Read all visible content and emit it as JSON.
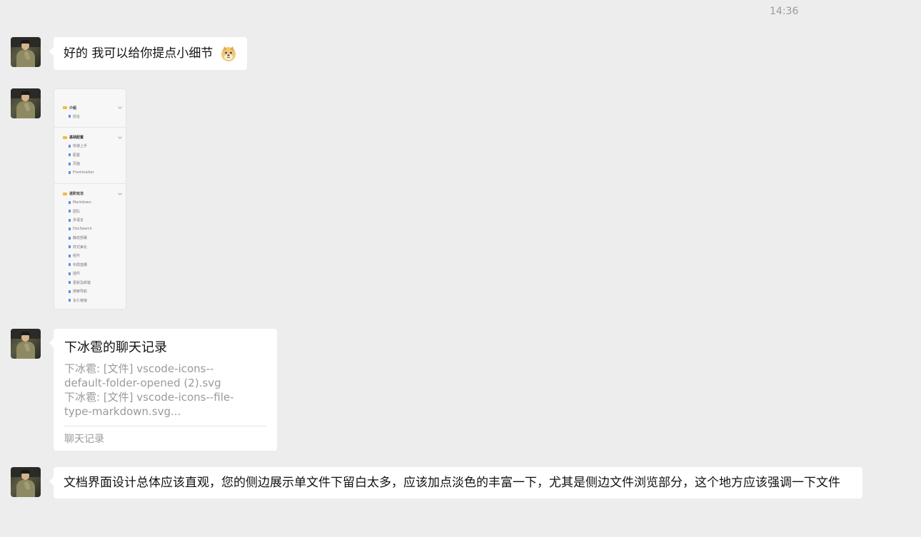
{
  "timestamp": "14:36",
  "messages": {
    "m1": {
      "text": "好的 我可以给你提点小细节"
    },
    "m2": {
      "image": {
        "groups": [
          {
            "title": "介绍",
            "items": [
              "前言"
            ]
          },
          {
            "title": "基础配置",
            "items": [
              "快速上手",
              "配置",
              "页面",
              "Frontmatter"
            ]
          },
          {
            "title": "进阶玩法",
            "items": [
              "Markdown",
              "团队",
              "多语言",
              "DocSearch",
              "静态部署",
              "样式美化",
              "组件",
              "布局插槽",
              "插件",
              "更新及卸载",
              "搜索导航",
              "永久链接"
            ]
          }
        ]
      }
    },
    "m3": {
      "title": "下冰雹的聊天记录",
      "lines": [
        "下冰雹: [文件] vscode-icons--",
        "default-folder-opened (2).svg",
        "下冰雹: [文件] vscode-icons--file-",
        "type-markdown.svg..."
      ],
      "footer": "聊天记录"
    },
    "m4": {
      "text": "文档界面设计总体应该直观，您的侧边展示单文件下留白太多，应该加点淡色的丰富一下，尤其是侧边文件浏览部分，这个地方应该强调一下文件"
    }
  }
}
